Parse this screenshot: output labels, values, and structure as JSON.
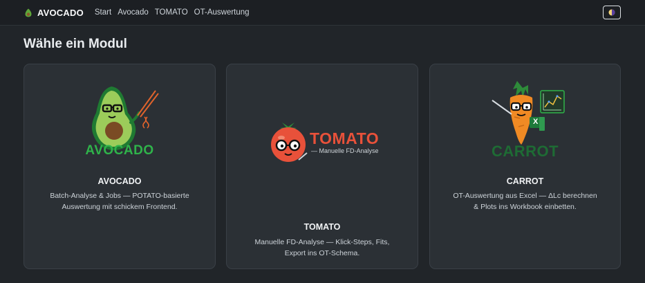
{
  "navbar": {
    "brand": "AVOCADO",
    "links": [
      "Start",
      "Avocado",
      "TOMATO",
      "OT-Auswertung"
    ]
  },
  "page": {
    "title": "Wähle ein Modul"
  },
  "modules": [
    {
      "logo_text": "AVOCADO",
      "title": "AVOCADO",
      "description": "Batch-Analyse & Jobs — POTATO-basierte Auswertung mit schickem Frontend."
    },
    {
      "logo_text": "TOMATO",
      "logo_subtext": "— Manuelle FD-Analyse",
      "title": "TOMATO",
      "description": "Manuelle FD-Analyse — Klick-Steps, Fits, Export ins OT-Schema."
    },
    {
      "logo_text": "CARROT",
      "title": "CARROT",
      "description": "OT-Auswertung aus Excel — ΔLc berechnen & Plots ins Workbook einbetten."
    }
  ],
  "colors": {
    "background": "#212529",
    "card": "#2b3035",
    "avocado_green": "#2fb34a",
    "tomato_red": "#e8513a",
    "carrot_green": "#1e6b34"
  }
}
